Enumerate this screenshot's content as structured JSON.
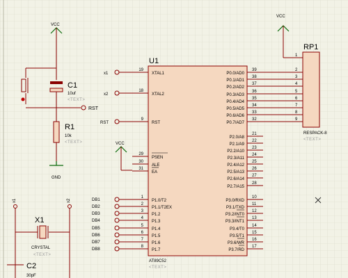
{
  "colors": {
    "background": "#f2f2e6",
    "grid": "#d8d8c8",
    "component_body": "#f5d8c0",
    "wire": "#8a0000",
    "power": "#0a6a0a",
    "junction": "#c00000"
  },
  "u1": {
    "ref": "U1",
    "part": "AT89C52",
    "left_pins": [
      {
        "num": "19",
        "name": "XTAL1"
      },
      {
        "num": "18",
        "name": "XTAL2"
      },
      {
        "num": "9",
        "name": "RST"
      },
      {
        "num": "29",
        "name": "PSEN"
      },
      {
        "num": "30",
        "name": "ALE"
      },
      {
        "num": "31",
        "name": "EA"
      },
      {
        "num": "1",
        "name": "P1.0/T2"
      },
      {
        "num": "2",
        "name": "P1.1/T2EX"
      },
      {
        "num": "3",
        "name": "P1.2"
      },
      {
        "num": "4",
        "name": "P1.3"
      },
      {
        "num": "5",
        "name": "P1.4"
      },
      {
        "num": "6",
        "name": "P1.5"
      },
      {
        "num": "7",
        "name": "P1.6"
      },
      {
        "num": "8",
        "name": "P1.7"
      }
    ],
    "right_pins": [
      {
        "num": "39",
        "name": "P0.0/AD0"
      },
      {
        "num": "38",
        "name": "P0.1/AD1"
      },
      {
        "num": "37",
        "name": "P0.2/AD2"
      },
      {
        "num": "36",
        "name": "P0.3/AD3"
      },
      {
        "num": "35",
        "name": "P0.4/AD4"
      },
      {
        "num": "34",
        "name": "P0.5/AD5"
      },
      {
        "num": "33",
        "name": "P0.6/AD6"
      },
      {
        "num": "32",
        "name": "P0.7/AD7"
      },
      {
        "num": "21",
        "name": "P2.0/A8"
      },
      {
        "num": "22",
        "name": "P2.1/A9"
      },
      {
        "num": "23",
        "name": "P2.2/A10"
      },
      {
        "num": "24",
        "name": "P2.3/A11"
      },
      {
        "num": "25",
        "name": "P2.4/A12"
      },
      {
        "num": "26",
        "name": "P2.5/A13"
      },
      {
        "num": "27",
        "name": "P2.6/A14"
      },
      {
        "num": "28",
        "name": "P2.7/A15"
      },
      {
        "num": "10",
        "name": "P3.0/RXD"
      },
      {
        "num": "11",
        "name": "P3.1/TXD"
      },
      {
        "num": "12",
        "name": "P3.2/INT0"
      },
      {
        "num": "13",
        "name": "P3.3/INT1"
      },
      {
        "num": "14",
        "name": "P3.4/T0"
      },
      {
        "num": "15",
        "name": "P3.5/T1"
      },
      {
        "num": "16",
        "name": "P3.6/WR"
      },
      {
        "num": "17",
        "name": "P3.7/RD"
      }
    ]
  },
  "labels": {
    "x1_net": "x1",
    "x2_net": "x2",
    "rst_net": "RST",
    "rst_net_c1": "RST",
    "db": [
      "DB1",
      "DB2",
      "DB3",
      "DB4",
      "DB5",
      "DB6",
      "DB7",
      "DB8"
    ],
    "xtal_x1": "x1",
    "xtal_x2": "x2"
  },
  "power": {
    "vcc_top": "VCC",
    "vcc_ea": "VCC",
    "vcc_rp1": "VCC",
    "gnd": "GND"
  },
  "c1": {
    "ref": "C1",
    "value": "10uf",
    "text": "<TEXT>"
  },
  "r1": {
    "ref": "R1",
    "value": "10k",
    "text": "<TEXT>"
  },
  "x1": {
    "ref": "X1",
    "value": "CRYSTAL",
    "text": "<TEXT>"
  },
  "c2": {
    "ref": "C2",
    "value": "30pF"
  },
  "rp1": {
    "ref": "RP1",
    "part": "RESPACK-8",
    "text": "<TEXT>",
    "pins": [
      "1",
      "2",
      "3",
      "4",
      "5",
      "6",
      "7",
      "8",
      "9"
    ]
  },
  "u1_text": "<TEXT>"
}
